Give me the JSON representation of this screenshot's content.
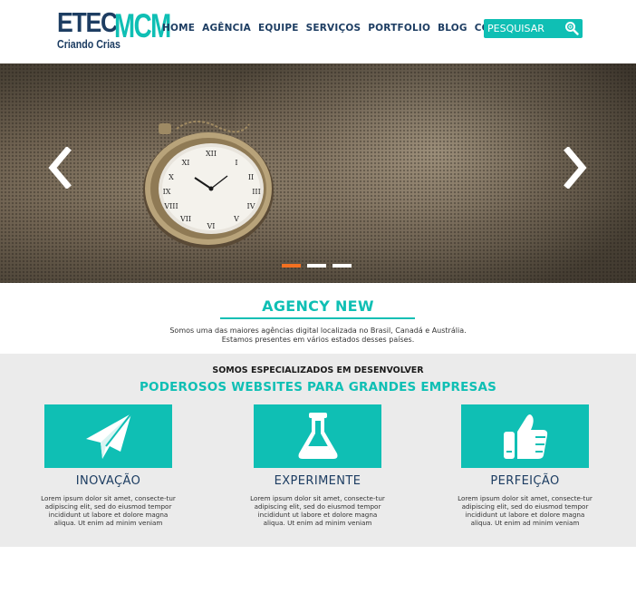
{
  "logo": {
    "etec": "ETEC",
    "mcm": "MCM",
    "subtitle": "Criando Crias"
  },
  "nav": {
    "items": [
      "HOME",
      "AGÊNCIA",
      "EQUIPE",
      "SERVIÇOS",
      "PORTFOLIO",
      "BLOG",
      "CONTATO"
    ]
  },
  "search": {
    "placeholder": "PESQUISAR",
    "icon": "search-icon"
  },
  "hero": {
    "slides": 3,
    "active_slide": 1,
    "prev_icon": "chevron-left-icon",
    "next_icon": "chevron-right-icon"
  },
  "agency": {
    "title": "AGENCY NEW",
    "line1": "Somos uma das maiores agências digital localizada no Brasil, Canadá e Austrália.",
    "line2": "Estamos presentes em vários estados desses países."
  },
  "services": {
    "kicker": "SOMOS ESPECIALIZADOS EM DESENVOLVER",
    "headline": "PODEROSOS WEBSITES PARA GRANDES EMPRESAS",
    "cards": [
      {
        "icon": "paper-plane-icon",
        "title": "INOVAÇÃO",
        "text": "Lorem ipsum dolor sit amet, consecte-tur adipiscing elit, sed do eiusmod tempor incididunt ut labore et dolore magna aliqua. Ut enim ad minim veniam"
      },
      {
        "icon": "flask-icon",
        "title": "EXPERIMENTE",
        "text": "Lorem ipsum dolor sit amet, consecte-tur adipiscing elit, sed do eiusmod tempor incididunt ut labore et dolore magna aliqua. Ut enim ad minim veniam"
      },
      {
        "icon": "thumbs-up-icon",
        "title": "PERFEIÇÃO",
        "text": "Lorem ipsum dolor sit amet, consecte-tur adipiscing elit, sed do eiusmod tempor incididunt ut labore et dolore magna aliqua. Ut enim ad minim veniam"
      }
    ]
  },
  "colors": {
    "accent": "#0fbfb4",
    "navy": "#1d3d62",
    "active_dot": "#f37021",
    "section_bg": "#ebebeb"
  }
}
